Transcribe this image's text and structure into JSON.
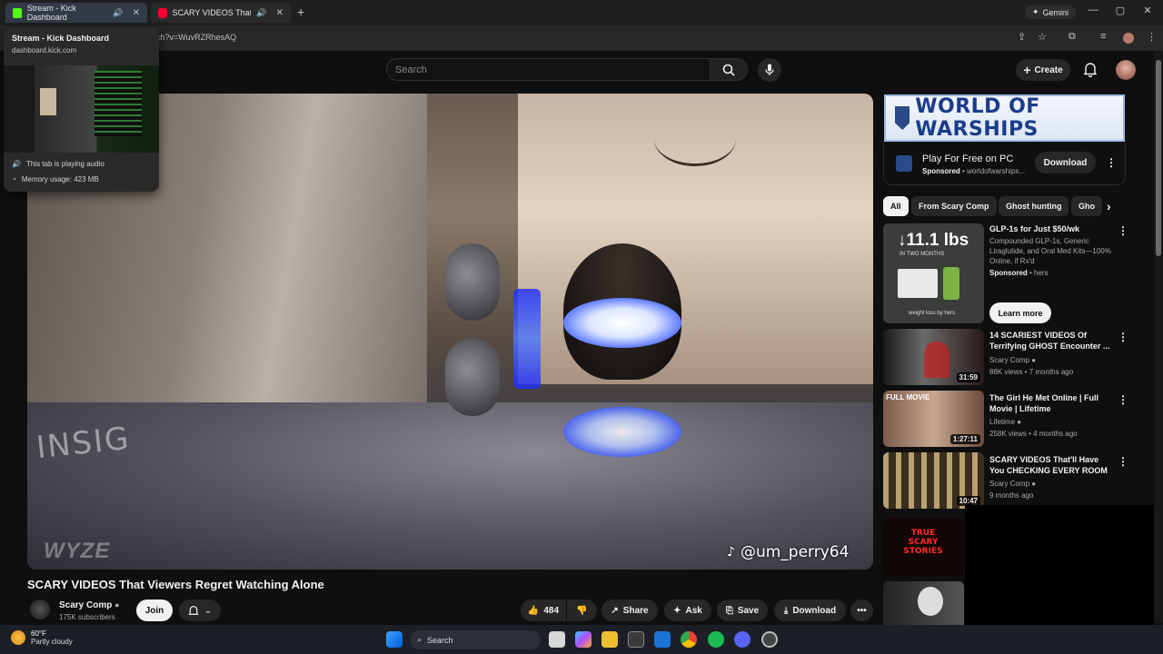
{
  "browser": {
    "tabs": [
      {
        "title": "Stream - Kick Dashboard",
        "favicon_color": "#53fc18"
      },
      {
        "title": "SCARY VIDEOS That Viewers",
        "favicon_color": "#ff0033"
      }
    ],
    "gemini_label": "Gemini",
    "url": "ch?v=WuvRZRhesAQ",
    "hover_card": {
      "title": "Stream - Kick Dashboard",
      "url": "dashboard.kick.com",
      "audio_note": "This tab is playing audio",
      "memory": "Memory usage: 423 MB"
    }
  },
  "youtube": {
    "search_placeholder": "Search",
    "create_label": "Create",
    "video": {
      "title": "SCARY VIDEOS That Viewers Regret Watching Alone",
      "watermark_brand": "INSIG",
      "camera_watermark": "WYZE",
      "tiktok_handle": "@um_perry64"
    },
    "channel": {
      "name": "Scary Comp",
      "subscribers": "175K subscribers",
      "join_label": "Join"
    },
    "actions": {
      "likes": "484",
      "share": "Share",
      "ask": "Ask",
      "save": "Save",
      "download": "Download"
    },
    "sidebar": {
      "ad": {
        "banner_text": "WORLD OF WARSHIPS",
        "title": "Play For Free on PC",
        "sponsored": "Sponsored",
        "advertiser": "worldofwarships...",
        "download_label": "Download"
      },
      "chips": [
        "All",
        "From Scary Comp",
        "Ghost hunting",
        "Gho"
      ],
      "items": [
        {
          "title": "GLP-1s for Just $50/wk",
          "desc": "Compounded GLP-1s, Generic Liraglutide, and Oral Med Kits—100% Online, if Rx'd",
          "sponsored": "Sponsored",
          "advertiser": "hers",
          "cta": "Learn more",
          "thumb_big": "↓11.1 lbs",
          "thumb_sub": "IN TWO MONTHS",
          "thumb_caption": "weight loss by hers"
        },
        {
          "title": "14 SCARIEST VIDEOS Of Terrifying GHOST Encounter ...",
          "channel": "Scary Comp",
          "meta": "88K views • 7 months ago",
          "duration": "31:59"
        },
        {
          "title": "The Girl He Met Online | Full Movie | Lifetime",
          "channel": "Lifetime",
          "meta": "258K views • 4 months ago",
          "duration": "1:27:11",
          "badge": "FULL MOVIE"
        },
        {
          "title": "SCARY VIDEOS That'll Have You CHECKING EVERY ROOM",
          "channel": "Scary Comp",
          "meta": "9 months ago",
          "duration": "10:47"
        }
      ],
      "extra_thumb_text": "TRUE SCARY STORIES"
    }
  },
  "taskbar": {
    "temperature": "60°F",
    "condition": "Partly cloudy",
    "search_label": "Search"
  }
}
